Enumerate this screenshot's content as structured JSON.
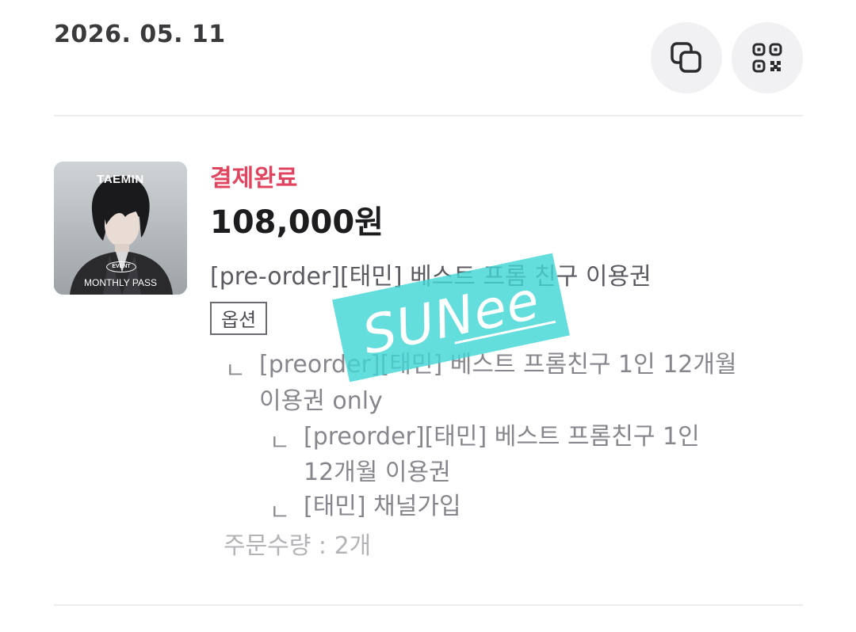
{
  "order": {
    "date": "2026. 05. 11"
  },
  "actions": {
    "copy_icon": "copy-icon",
    "qr_icon": "qr-code-icon"
  },
  "item": {
    "thumbnail": {
      "artist": "TAEMIN",
      "badge": "EVENT",
      "pass_name": "MONTHLY PASS"
    },
    "status": "결제완료",
    "price": "108,000원",
    "product_name": "[pre-order][태민] 베스트 프롬 친구 이용권",
    "option_label": "옵션",
    "options": [
      {
        "marker": "ㄴ",
        "text_line1": "[preorder][태민] 베스트 프롬친구 1인 12개월",
        "text_line2": "이용권 only"
      },
      {
        "marker": "ㄴ",
        "text_line1": "[preorder][태민] 베스트 프롬친구 1인",
        "text_line2": "12개월 이용권"
      },
      {
        "marker": "ㄴ",
        "text_line1": "[태민] 채널가입"
      }
    ],
    "quantity": "주문수량 : 2개"
  },
  "watermark": {
    "text": "SUNee",
    "color": "#43d6d6"
  },
  "colors": {
    "status": "#e0445f",
    "price": "#1d1d1f",
    "divider": "#ececee",
    "button_bg": "#f1f1f3"
  }
}
